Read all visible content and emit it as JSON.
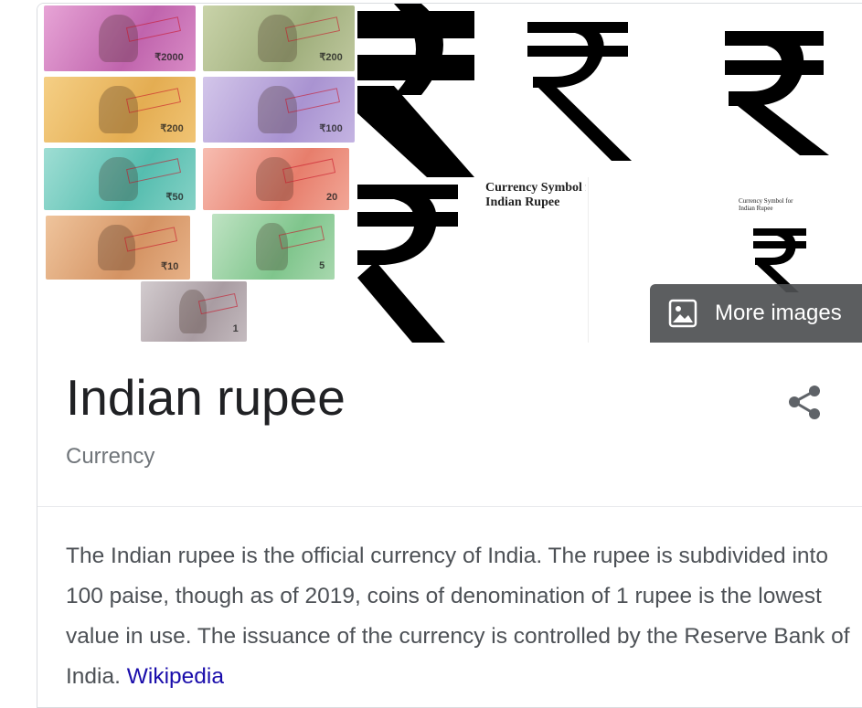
{
  "gallery": {
    "banknotes": [
      {
        "value": "₹2000",
        "color": "#d47fc0"
      },
      {
        "value": "₹200",
        "color": "#a9b98a"
      },
      {
        "value": "₹200",
        "color": "#e9b864"
      },
      {
        "value": "₹100",
        "color": "#b7a3d8"
      },
      {
        "value": "₹50",
        "color": "#66c6b8"
      },
      {
        "value": "20",
        "color": "#ec8f7f"
      },
      {
        "value": "₹10",
        "color": "#d9a070"
      },
      {
        "value": "5",
        "color": "#8ecb99"
      },
      {
        "value": "1",
        "color": "#b5a9ae"
      }
    ],
    "symbol_caption_1": "Currency Symbol for\nIndian Rupee",
    "symbol_caption_2": "Currency Symbol for\nIndian Rupee",
    "more_images_label": "More images",
    "more_images_icon": "image-icon"
  },
  "entity": {
    "title": "Indian rupee",
    "subtitle": "Currency",
    "share_icon": "share-icon"
  },
  "description": {
    "text": "The Indian rupee is the official currency of India. The rupee is subdivided into 100 paise, though as of 2019, coins of denomination of 1 rupee is the lowest value in use. The issuance of the currency is controlled by the Reserve Bank of India.",
    "source_link": "Wikipedia"
  },
  "colors": {
    "title": "#202124",
    "subtitle": "#70757a",
    "body_text": "#4d5156",
    "link": "#1a0dab",
    "overlay": "#4e5052"
  }
}
